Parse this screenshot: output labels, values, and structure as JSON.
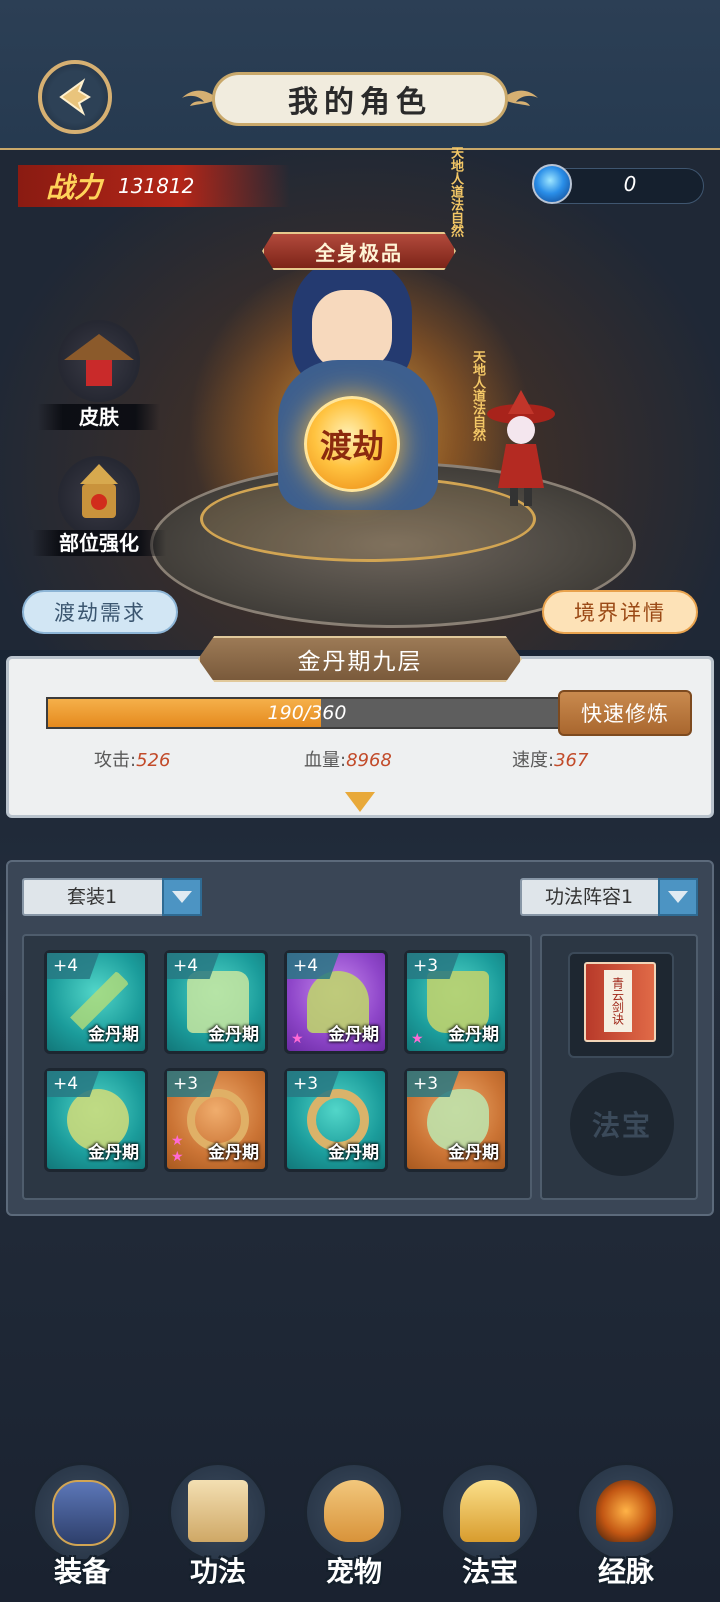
{
  "header": {
    "title": "我的角色"
  },
  "top": {
    "power_label": "战力",
    "power_value": "131812",
    "gem_value": "0"
  },
  "stage": {
    "ribbon": "全身极品",
    "dujie": "渡劫",
    "scroll_left": "天地人道法自然",
    "scroll_right": "天地人道法自然",
    "skin_label": "皮肤",
    "enhance_label": "部位强化",
    "dujie_need": "渡劫需求",
    "realm_detail": "境界详情"
  },
  "realm": {
    "title": "金丹期九层",
    "progress_text": "190/360",
    "progress_current": 190,
    "progress_max": 360,
    "quick_train": "快速修炼",
    "stats": [
      {
        "label": "攻击:",
        "value": "526"
      },
      {
        "label": "血量:",
        "value": "8968"
      },
      {
        "label": "速度:",
        "value": "367"
      }
    ]
  },
  "equip": {
    "set_dropdown": "套装1",
    "formation_dropdown": "功法阵容1",
    "slots": [
      {
        "level": "+4",
        "stage": "金丹期",
        "rarity": "teal",
        "stars": 0
      },
      {
        "level": "+4",
        "stage": "金丹期",
        "rarity": "teal",
        "stars": 0
      },
      {
        "level": "+4",
        "stage": "金丹期",
        "rarity": "purple",
        "stars": 1
      },
      {
        "level": "+3",
        "stage": "金丹期",
        "rarity": "teal",
        "stars": 1
      },
      {
        "level": "+4",
        "stage": "金丹期",
        "rarity": "teal",
        "stars": 0
      },
      {
        "level": "+3",
        "stage": "金丹期",
        "rarity": "orange",
        "stars": 2
      },
      {
        "level": "+3",
        "stage": "金丹期",
        "rarity": "teal",
        "stars": 0
      },
      {
        "level": "+3",
        "stage": "金丹期",
        "rarity": "orange",
        "stars": 0
      }
    ],
    "book_title": "青云剑诀",
    "fabao_placeholder": "法宝"
  },
  "nav": [
    {
      "label": "装备",
      "icon": "armor-icon"
    },
    {
      "label": "功法",
      "icon": "scroll-book-icon"
    },
    {
      "label": "宠物",
      "icon": "dragon-pet-icon"
    },
    {
      "label": "法宝",
      "icon": "golden-bell-icon"
    },
    {
      "label": "经脉",
      "icon": "meridian-flame-icon"
    }
  ],
  "colors": {
    "accent_gold": "#c9a86a",
    "progress_fill": "#e58a1e",
    "stat_value": "#c24b2a"
  }
}
